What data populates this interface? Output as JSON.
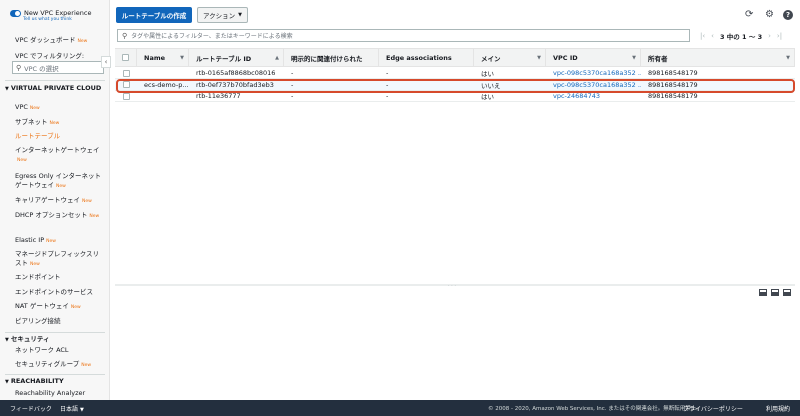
{
  "sidebar": {
    "toggle_label": "New VPC Experience",
    "toggle_sub": "Tell us what you think",
    "dashboard": "VPC ダッシュボード",
    "new_badge": "New",
    "filter_label": "VPC でフィルタリング:",
    "vpc_select_placeholder": "VPC の選択",
    "section_vpc": "VIRTUAL PRIVATE CLOUD",
    "items": [
      {
        "label": "VPC",
        "new": true
      },
      {
        "label": "サブネット",
        "new": true
      },
      {
        "label": "ルートテーブル",
        "new": false
      },
      {
        "label": "インターネットゲートウェイ",
        "new": true
      },
      {
        "label": "Egress Only インターネットゲートウェイ",
        "new": true
      },
      {
        "label": "キャリアゲートウェイ",
        "new": true
      },
      {
        "label": "DHCP オプションセット",
        "new": true
      },
      {
        "label": "Elastic IP",
        "new": true
      },
      {
        "label": "マネージドプレフィックスリスト",
        "new": true
      },
      {
        "label": "エンドポイント",
        "new": false
      },
      {
        "label": "エンドポイントのサービス",
        "new": false
      },
      {
        "label": "NAT ゲートウェイ",
        "new": true
      },
      {
        "label": "ピアリング接続",
        "new": false
      }
    ],
    "section_security": "セキュリティ",
    "security_items": [
      {
        "label": "ネットワーク ACL",
        "new": false
      },
      {
        "label": "セキュリティグループ",
        "new": true
      }
    ],
    "section_reachability": "REACHABILITY",
    "reachability_items": [
      {
        "label": "Reachability Analyzer",
        "new": false
      }
    ]
  },
  "toolbar": {
    "create_label": "ルートテーブルの作成",
    "action_label": "アクション"
  },
  "search": {
    "placeholder": "タグや属性によるフィルター、またはキーワードによる検索"
  },
  "pager": {
    "text": "3 中の 1 ～ 3"
  },
  "table": {
    "headers": [
      "Name",
      "ルートテーブル ID",
      "明示的に関連付けられた",
      "Edge associations",
      "メイン",
      "VPC ID",
      "所有者"
    ],
    "rows": [
      {
        "name": "",
        "id": "rtb-0165af8868bc08016",
        "explicit": "-",
        "edge": "-",
        "main": "はい",
        "vpc": "vpc-098c5370ca168a352 ...",
        "owner": "898168548179"
      },
      {
        "name": "ecs-demo-p...",
        "id": "rtb-0ef737b70bfad3eb3",
        "explicit": "-",
        "edge": "-",
        "main": "いいえ",
        "vpc": "vpc-098c5370ca168a352 ...",
        "owner": "898168548179"
      },
      {
        "name": "",
        "id": "rtb-11e36777",
        "explicit": "-",
        "edge": "-",
        "main": "はい",
        "vpc": "vpc-24684743",
        "owner": "898168548179"
      }
    ]
  },
  "footer": {
    "feedback": "フィードバック",
    "language": "日本語",
    "copyright": "© 2008 - 2020, Amazon Web Services, Inc. またはその関連会社。無断転用禁止。",
    "privacy": "プライバシーポリシー",
    "terms": "利用規約"
  },
  "colors": {
    "accent": "#1166bb",
    "active": "#ec7211",
    "highlight": "#d64a2c",
    "footer_bg": "#232f3e"
  },
  "icons": [
    "refresh-icon",
    "gear-icon",
    "help-icon",
    "search-icon",
    "chevron-down-icon",
    "pager-first-icon",
    "pager-prev-icon",
    "pager-next-icon",
    "pager-last-icon"
  ]
}
